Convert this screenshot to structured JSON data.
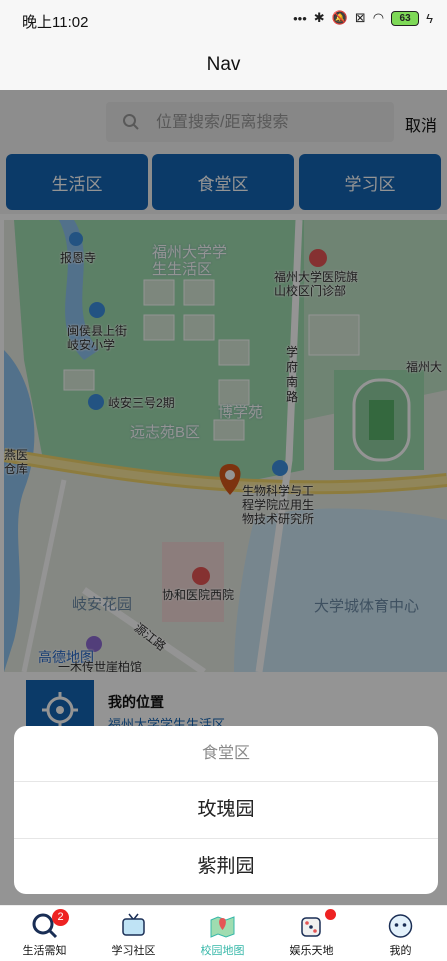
{
  "status_bar": {
    "time": "晚上11:02",
    "battery": "63"
  },
  "nav": {
    "title": "Nav"
  },
  "search": {
    "placeholder": "位置搜索/距离搜索",
    "cancel_label": "取消"
  },
  "areas": [
    "生活区",
    "食堂区",
    "学习区"
  ],
  "map": {
    "labels": {
      "baoen": "报恩寺",
      "fzu_living": "福州大学学\n生生活区",
      "hospital": "福州大学医院旗\n山校区门诊部",
      "minhou": "闽侯县上街\n岐安小学",
      "xuefu": "学\n府\n南\n路",
      "fuzhou_da": "福州大",
      "qian3": "岐安三号2期",
      "boxue": "博学苑",
      "yuanzhi": "远志苑B区",
      "yanyi": "燕医\n仓库",
      "biosci": "生物科学与工\n程学院应用生\n物技术研究所",
      "xiehe": "协和医院西院",
      "qianhua": "岐安花园",
      "stadium": "大学城体育中心",
      "yuanjiang": "源江路",
      "gaode": "高德地图",
      "guanbo": "一木传世崖柏馆"
    }
  },
  "my_location": {
    "title": "我的位置",
    "subtitle": "福州大学学生生活区"
  },
  "sheet": {
    "title": "食堂区",
    "options": [
      "玫瑰园",
      "紫荆园"
    ]
  },
  "tabs": [
    {
      "label": "生活需知",
      "icon": "search-magnifier-icon",
      "badge": "2"
    },
    {
      "label": "学习社区",
      "icon": "tv-icon"
    },
    {
      "label": "校园地图",
      "icon": "map-pin-icon",
      "active": true
    },
    {
      "label": "娱乐天地",
      "icon": "dice-icon",
      "dot": true
    },
    {
      "label": "我的",
      "icon": "face-icon"
    }
  ],
  "colors": {
    "primary": "#1464b4",
    "active_tab": "#35b7a8",
    "badge": "#ee2222"
  }
}
